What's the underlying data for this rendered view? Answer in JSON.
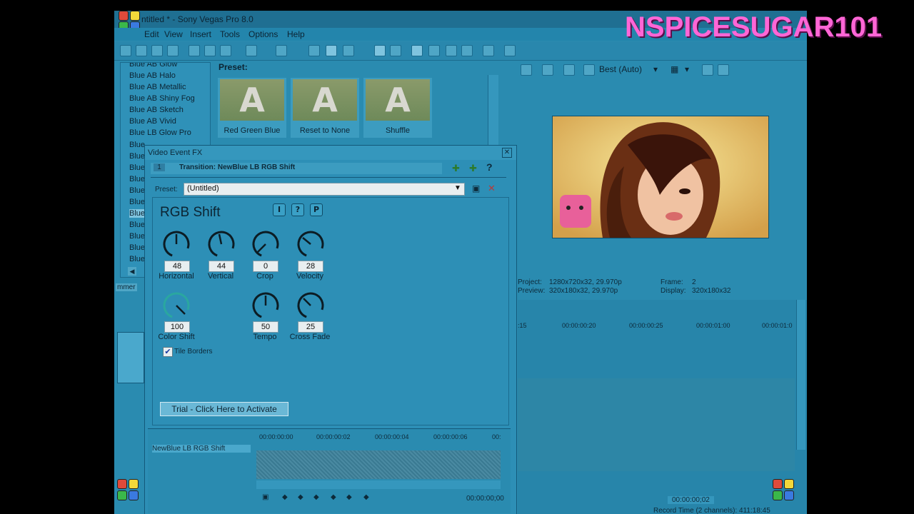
{
  "app": {
    "title": "Untitled * - Sony Vegas Pro 8.0",
    "title_visible": "ntitled * - Sony Vegas Pro 8.0"
  },
  "menu": [
    "Edit",
    "View",
    "Insert",
    "Tools",
    "Options",
    "Help"
  ],
  "fx_list": {
    "items": [
      "Blue AB Glow",
      "Blue AB Halo",
      "Blue AB Metallic",
      "Blue AB Shiny Fog",
      "Blue AB Sketch",
      "Blue AB Vivid",
      "Blue LB Glow Pro",
      "Blue",
      "Blue",
      "Blue",
      "Blue",
      "Blue",
      "Blue",
      "Blue",
      "Blue",
      "Blue",
      "Blue",
      "Blue"
    ],
    "tab_label": "mmer"
  },
  "presets": {
    "label": "Preset:",
    "thumbs": [
      {
        "caption": "Red Green Blue",
        "glyph": "A"
      },
      {
        "caption": "Reset to None",
        "glyph": "A"
      },
      {
        "caption": "Shuffle",
        "glyph": "A"
      }
    ]
  },
  "preview": {
    "quality": "Best (Auto)",
    "project_label": "Project:",
    "project_value": "1280x720x32, 29.970p",
    "preview_label": "Preview:",
    "preview_value": "320x180x32, 29.970p",
    "frame_label": "Frame:",
    "frame_value": "2",
    "display_label": "Display:",
    "display_value": "320x180x32"
  },
  "timeline": {
    "ticks": [
      ":15",
      "00:00:00:20",
      "00:00:00:25",
      "00:00:01:00",
      "00:00:01:0"
    ],
    "time": "00:00:00;02",
    "record_time": "Record Time (2 channels): 411:18:45"
  },
  "dialog": {
    "title": "Video Event FX",
    "chain_number": "1",
    "transition": "Transition: NewBlue LB RGB Shift",
    "preset_label": "Preset:",
    "preset_value": "(Untitled)",
    "plugin_name": "RGB Shift",
    "btn_i": "I",
    "btn_q": "?",
    "btn_p": "P",
    "knobs": [
      {
        "label": "Horizontal",
        "value": "48"
      },
      {
        "label": "Vertical",
        "value": "44"
      },
      {
        "label": "Crop",
        "value": "0"
      },
      {
        "label": "Velocity",
        "value": "28"
      },
      {
        "label": "Color Shift",
        "value": "100"
      },
      {
        "label": "Tempo",
        "value": "50"
      },
      {
        "label": "Cross Fade",
        "value": "25"
      }
    ],
    "tile_borders": "Tile Borders",
    "tile_borders_checked": true,
    "trial_button": "Trial - Click Here to Activate",
    "keyframe_track": "NewBlue LB RGB Shift",
    "kf_ticks": [
      "00:00:00:00",
      "00:00:00:02",
      "00:00:00:04",
      "00:00:00:06",
      "00:"
    ],
    "kf_time": "00:00:00;00"
  },
  "watermark": "NSPICESUGAR101",
  "colors": {
    "app_bg": "#2a8bb0",
    "watermark": "#ff66d6"
  }
}
